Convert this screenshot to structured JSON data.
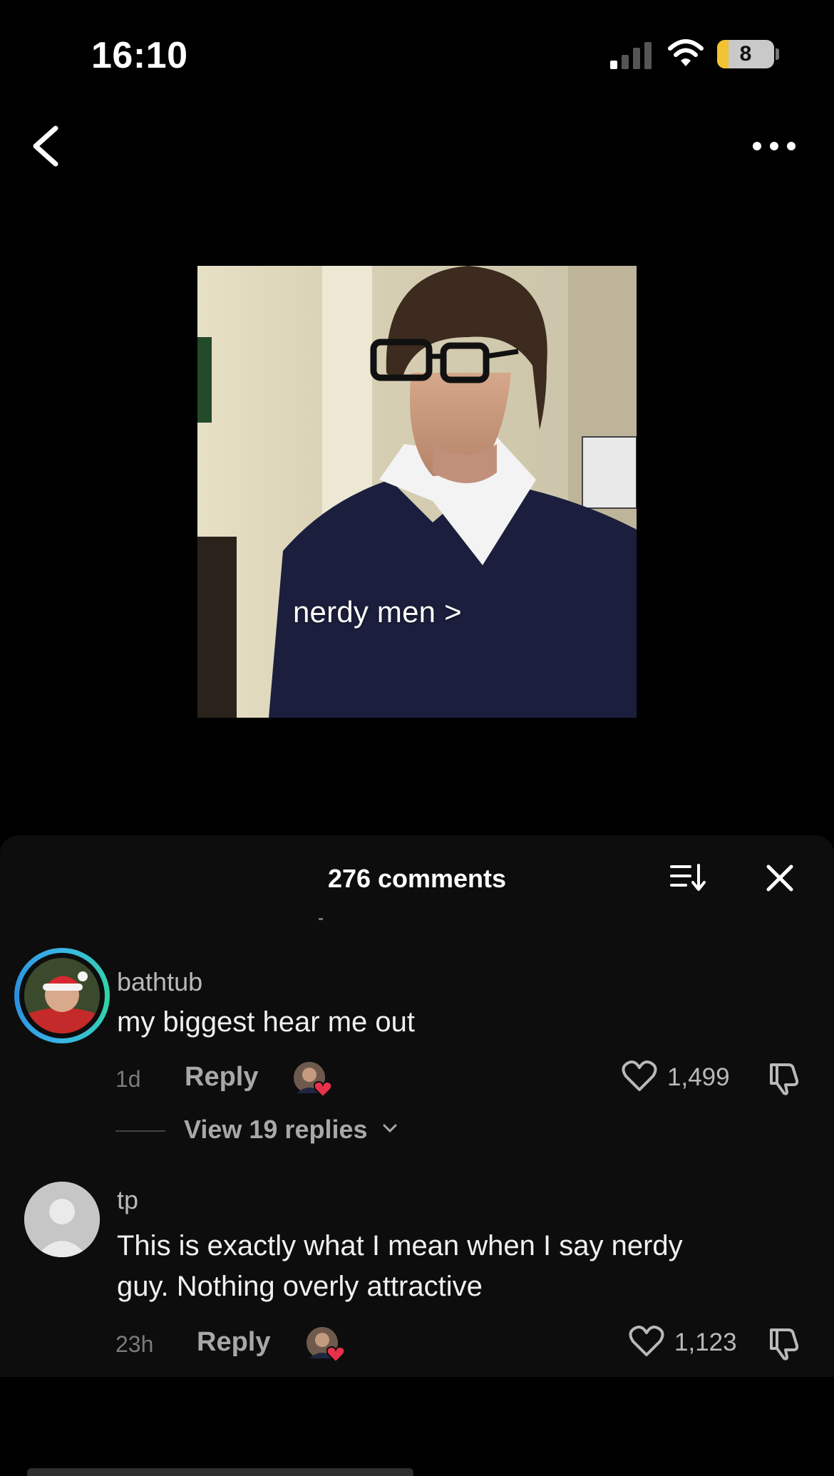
{
  "status_bar": {
    "time": "16:10",
    "battery_level": "8",
    "icons": [
      "cellular-signal-icon",
      "wifi-icon",
      "battery-icon"
    ]
  },
  "nav": {
    "back_icon": "chevron-left-icon",
    "more_icon": "ellipsis-icon"
  },
  "video": {
    "caption": "nerdy men >"
  },
  "comments_panel": {
    "title": "276 comments",
    "sort_icon": "sort-icon",
    "close_icon": "close-icon",
    "comments": [
      {
        "username": "bathtub",
        "text": "my biggest hear me out",
        "time": "1d",
        "reply_label": "Reply",
        "likes": "1,499",
        "view_replies": "View 19 replies"
      },
      {
        "username": "tp",
        "text_line1": "This is exactly what I mean when I say nerdy",
        "text_line2": "guy. Nothing overly attractive",
        "time": "23h",
        "reply_label": "Reply",
        "likes": "1,123"
      }
    ]
  },
  "colors": {
    "background": "#000000",
    "panel": "#0d0d0d",
    "story_ring": "#3ab5e6",
    "heart_red": "#e8314a"
  }
}
